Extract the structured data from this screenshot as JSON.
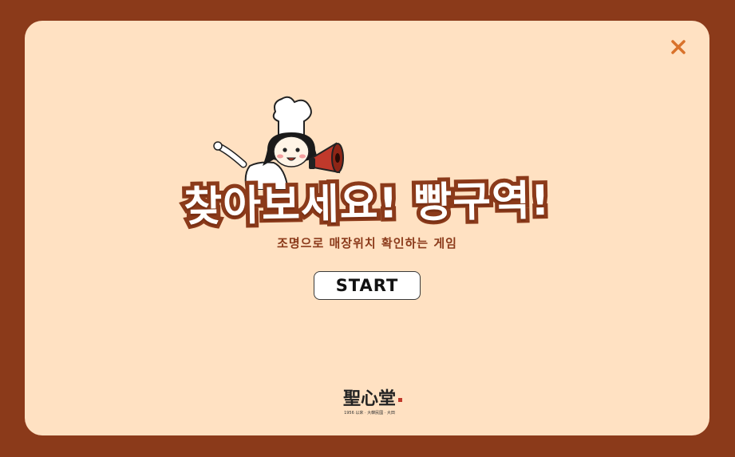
{
  "popup": {
    "title": "찾아보세요! 빵구역!",
    "subtitle": "조명으로 매장위치 확인하는 게임",
    "start_label": "START"
  },
  "brand": {
    "logo_text": "聖心堂",
    "logo_subtext": "1956 以來 · 大韓民國 · 大田"
  },
  "icons": {
    "close": "close-icon",
    "mascot": "chef-with-megaphone-illustration"
  },
  "colors": {
    "frame": "#8b3a1a",
    "card": "#ffe1c2",
    "accent": "#d9722b",
    "title_fill": "#ffffff",
    "title_outline": "#8b3a1a"
  }
}
